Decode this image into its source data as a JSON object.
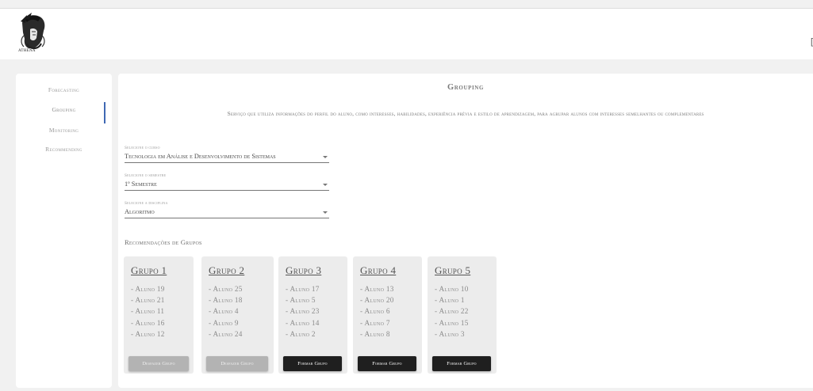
{
  "header": {
    "logo_text": "ATHENA",
    "edge_glyph": "["
  },
  "sidebar": {
    "items": [
      {
        "label": "Forecasting"
      },
      {
        "label": "Grouping"
      },
      {
        "label": "Monitoring"
      },
      {
        "label": "Recommending"
      }
    ],
    "active_index": 1
  },
  "main": {
    "title": "Grouping",
    "description": "Serviço que utiliza informações do perfil do aluno, como interesses, habilidades, experiência prévia e estilo de aprendizagem, para agrupar alunos com interesses semelhantes ou complementares",
    "selects": [
      {
        "label": "Selecione o curso",
        "value": "Tecnologia em Análise e Desenvolvimento de Sistemas"
      },
      {
        "label": "Selecione o semestre",
        "value": "1º Semestre"
      },
      {
        "label": "Selecione a disciplina",
        "value": "Algoritmo"
      }
    ],
    "recommendations_title": "Recomendações de Grupos",
    "groups": [
      {
        "title": "Grupo 1",
        "members": [
          "- Aluno 19",
          "- Aluno 21",
          "- Aluno 11",
          "- Aluno 16",
          "- Aluno 12"
        ],
        "button": "Desfazer Grupo",
        "button_state": "undo"
      },
      {
        "title": "Grupo 2",
        "members": [
          "- Aluno 25",
          "- Aluno 18",
          "- Aluno 4",
          "- Aluno 9",
          "- Aluno 24"
        ],
        "button": "Desfazer Grupo",
        "button_state": "undo"
      },
      {
        "title": "Grupo 3",
        "members": [
          "- Aluno 17",
          "- Aluno 5",
          "- Aluno 23",
          "- Aluno 14",
          "- Aluno 2"
        ],
        "button": "Formar Grupo",
        "button_state": "form"
      },
      {
        "title": "Grupo 4",
        "members": [
          "- Aluno 13",
          "- Aluno 20",
          "- Aluno 6",
          "- Aluno 7",
          "- Aluno 8"
        ],
        "button": "Formar Grupo",
        "button_state": "form"
      },
      {
        "title": "Grupo 5",
        "members": [
          "- Aluno 10",
          "- Aluno 1",
          "- Aluno 22",
          "- Aluno 15",
          "- Aluno 3"
        ],
        "button": "Formar Grupo",
        "button_state": "form"
      }
    ]
  },
  "colors": {
    "active_indicator": "#3f68b3",
    "button_dark": "#1f1f1f",
    "button_disabled": "#b3b3b3",
    "card_bg": "#ececec",
    "page_bg": "#f1f1f1"
  },
  "icons": {
    "logo": "athena-helmet-logo",
    "select_arrow": "caret-down-icon"
  }
}
